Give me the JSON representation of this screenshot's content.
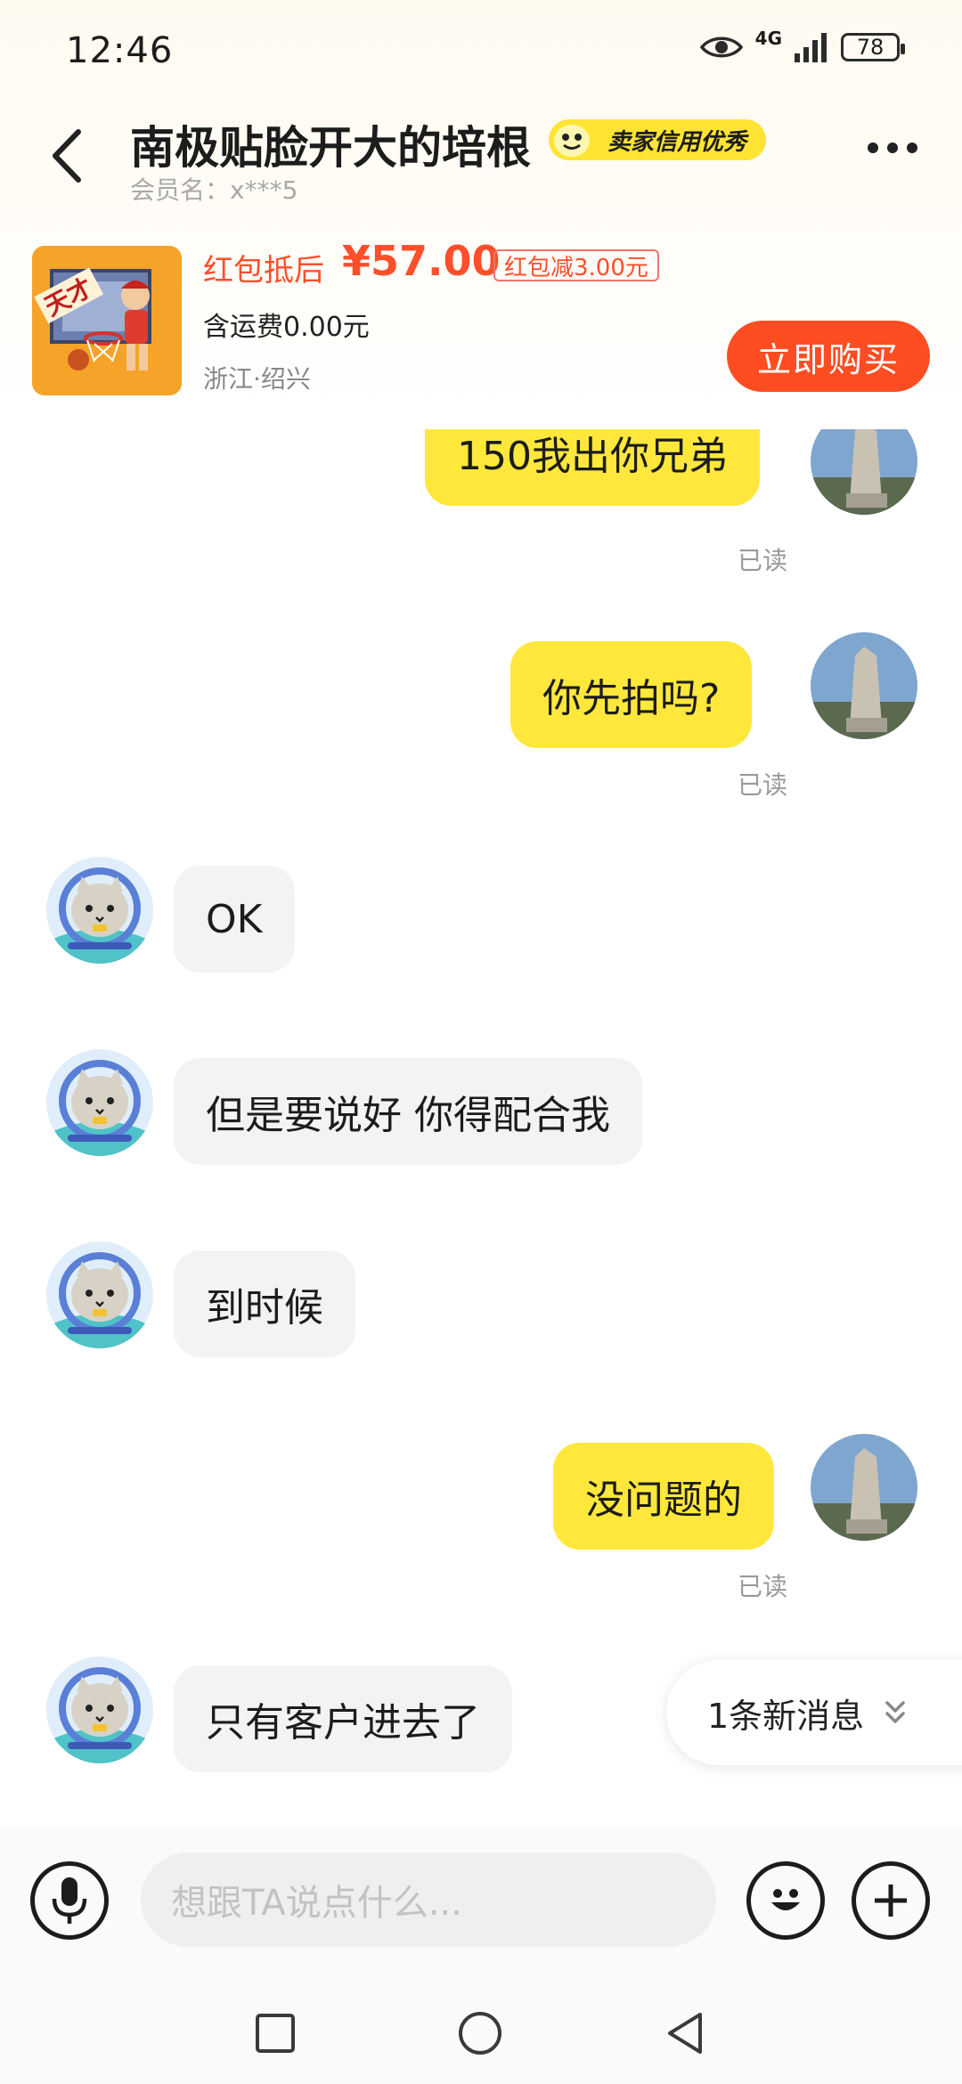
{
  "status_bar": {
    "time": "12:46",
    "network": "4G",
    "battery": "78"
  },
  "header": {
    "title": "南极贴脸开大的培根",
    "credit_badge": "卖家信用优秀",
    "member": "会员名：x***5"
  },
  "product": {
    "price_label": "红包抵后",
    "price": "¥57.00",
    "coupon": "红包减3.00元",
    "shipping": "含运费0.00元",
    "location": "浙江·绍兴",
    "buy_button": "立即购买"
  },
  "messages": [
    {
      "side": "me",
      "text": "150我出你兄弟",
      "status": "已读"
    },
    {
      "side": "me",
      "text": "你先拍吗?",
      "status": "已读"
    },
    {
      "side": "them",
      "text": "OK"
    },
    {
      "side": "them",
      "text": "但是要说好 你得配合我"
    },
    {
      "side": "them",
      "text": "到时候"
    },
    {
      "side": "me",
      "text": "没问题的",
      "status": "已读"
    },
    {
      "side": "them",
      "text": "只有客户进去了"
    }
  ],
  "new_message_indicator": "1条新消息",
  "input": {
    "placeholder": "想跟TA说点什么..."
  },
  "colors": {
    "accent_yellow": "#ffe83b",
    "price_red": "#ff4e2a",
    "buy_button": "#ff4d22"
  }
}
